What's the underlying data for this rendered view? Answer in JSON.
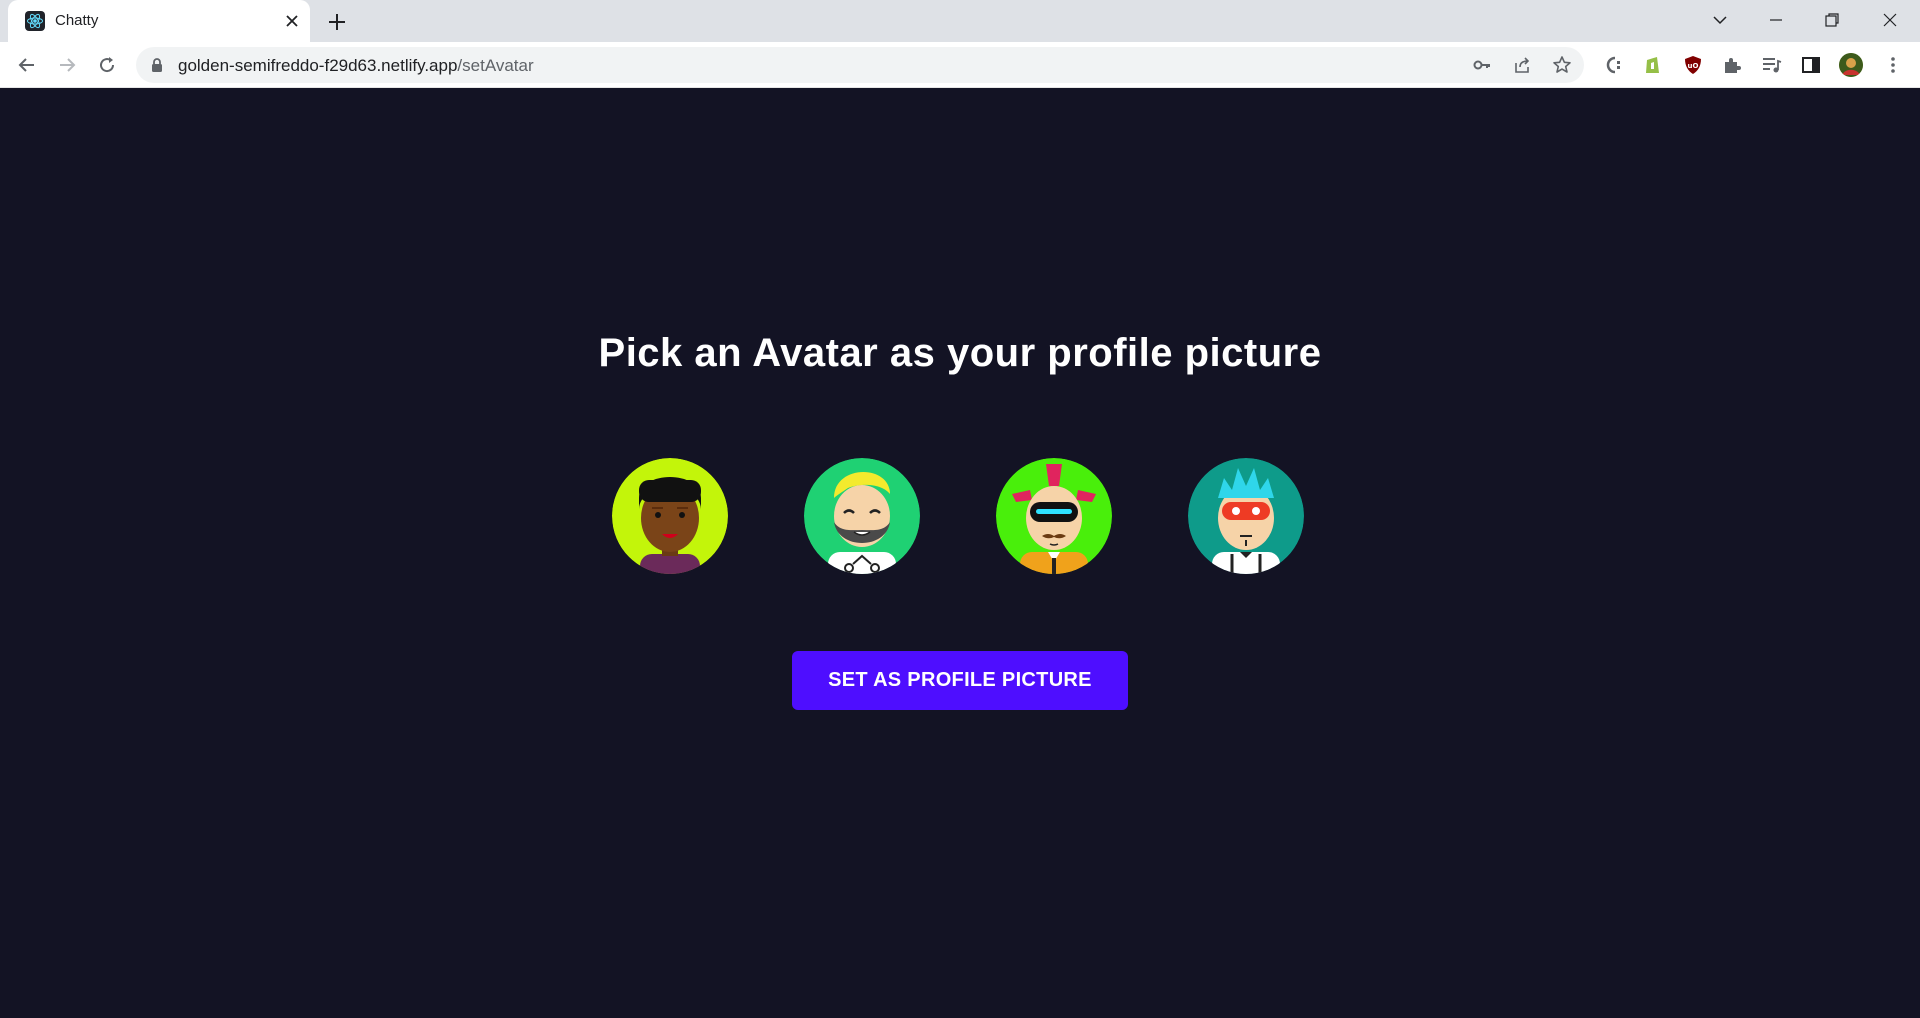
{
  "browser": {
    "tab_title": "Chatty",
    "url_host": "golden-semifreddo-f29d63.netlify.app",
    "url_path": "/setAvatar",
    "favicon": "react-icon"
  },
  "page": {
    "heading": "Pick an Avatar as your profile picture",
    "button_label": "SET AS PROFILE PICTURE",
    "avatars": [
      {
        "name": "avatar-option-1",
        "bg": "#c3f50a"
      },
      {
        "name": "avatar-option-2",
        "bg": "#1fd173"
      },
      {
        "name": "avatar-option-3",
        "bg": "#49ef0b"
      },
      {
        "name": "avatar-option-4",
        "bg": "#0e9b8a"
      }
    ]
  },
  "colors": {
    "background": "#131324",
    "accent": "#4e0eff"
  }
}
